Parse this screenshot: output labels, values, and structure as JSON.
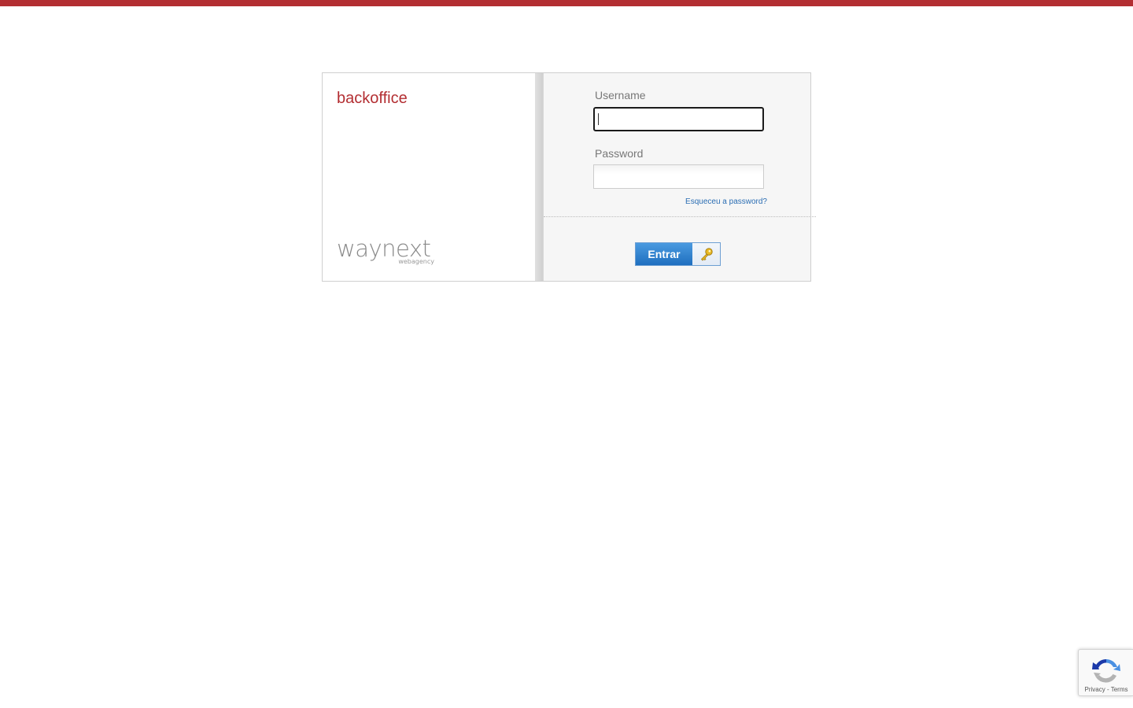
{
  "colors": {
    "brand": "#b32e32",
    "link": "#2a6db3",
    "button": "#1f6fbf"
  },
  "brand": {
    "title": "backoffice"
  },
  "logo": {
    "name": "waynext",
    "tagline": "webagency"
  },
  "form": {
    "username_label": "Username",
    "username_value": "",
    "password_label": "Password",
    "password_value": "",
    "forgot_link": "Esqueceu a password?",
    "submit_label": "Entrar",
    "submit_icon": "key-icon"
  },
  "recaptcha": {
    "icon": "recaptcha-icon",
    "privacy": "Privacy",
    "separator": " - ",
    "terms": "Terms"
  }
}
